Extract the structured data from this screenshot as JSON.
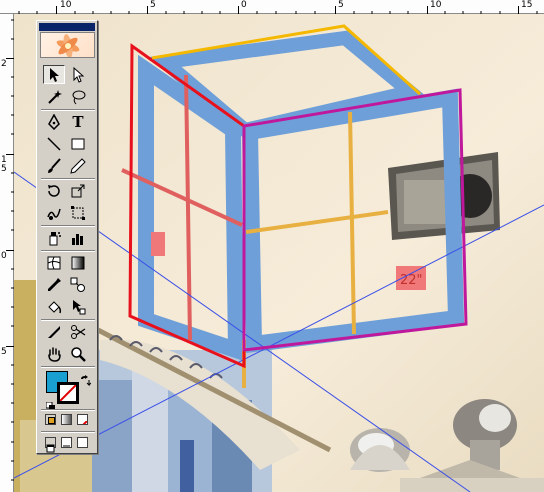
{
  "rulers": {
    "top_labels": [
      "10",
      "5",
      "0",
      "5",
      "10",
      "15"
    ],
    "left_labels": [
      "2",
      "1",
      "5",
      "0",
      "5"
    ]
  },
  "canvas": {
    "label_text": "22\"",
    "colors": {
      "wall": "#f4ead6",
      "tape_blue": "#6e9fd8",
      "left_frame": "#e8101c",
      "right_frame": "#c0189c",
      "top_frame": "#f4b800",
      "guide_line": "#3a4fe8",
      "crosshair_red": "#e06060",
      "crosshair_orange": "#e8b040",
      "tag_pink": "#f07878"
    }
  },
  "toolbox": {
    "tools": [
      {
        "name": "selection-tool-icon"
      },
      {
        "name": "direct-selection-tool-icon"
      },
      {
        "name": "magic-wand-tool-icon"
      },
      {
        "name": "lasso-tool-icon"
      },
      {
        "name": "pen-tool-icon"
      },
      {
        "name": "type-tool-icon",
        "glyph": "T"
      },
      {
        "name": "line-segment-tool-icon"
      },
      {
        "name": "rectangle-tool-icon"
      },
      {
        "name": "paintbrush-tool-icon"
      },
      {
        "name": "pencil-tool-icon"
      },
      {
        "name": "rotate-tool-icon"
      },
      {
        "name": "scale-tool-icon"
      },
      {
        "name": "warp-tool-icon"
      },
      {
        "name": "free-transform-tool-icon"
      },
      {
        "name": "symbol-sprayer-tool-icon"
      },
      {
        "name": "column-graph-tool-icon"
      },
      {
        "name": "mesh-tool-icon"
      },
      {
        "name": "gradient-tool-icon"
      },
      {
        "name": "eyedropper-tool-icon"
      },
      {
        "name": "blend-tool-icon"
      },
      {
        "name": "live-paint-bucket-tool-icon"
      },
      {
        "name": "live-paint-selection-tool-icon"
      },
      {
        "name": "slice-tool-icon"
      },
      {
        "name": "scissors-tool-icon"
      },
      {
        "name": "hand-tool-icon"
      },
      {
        "name": "zoom-tool-icon"
      }
    ],
    "fill_color": "#1aa0d0",
    "stroke_color": "none"
  }
}
